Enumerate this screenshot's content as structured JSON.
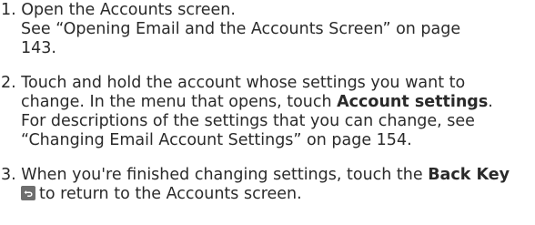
{
  "steps": [
    {
      "number": "1.",
      "lines": [
        "Open the Accounts screen.",
        "See “Opening Email and the Accounts Screen” on page",
        "143."
      ]
    },
    {
      "number": "2.",
      "line1": "Touch and hold the account whose settings you want to",
      "line2_pre": "change. In the menu that opens, touch ",
      "line2_bold": "Account settings",
      "line2_post": ".",
      "line3": "For descriptions of the settings that you can change, see",
      "line4": "“Changing Email Account Settings” on page 154."
    },
    {
      "number": "3.",
      "line1_pre": "When you're finished changing settings, touch the ",
      "line1_bold": "Back Key",
      "icon": "back-key-icon",
      "line2": "to return to the Accounts screen."
    }
  ]
}
